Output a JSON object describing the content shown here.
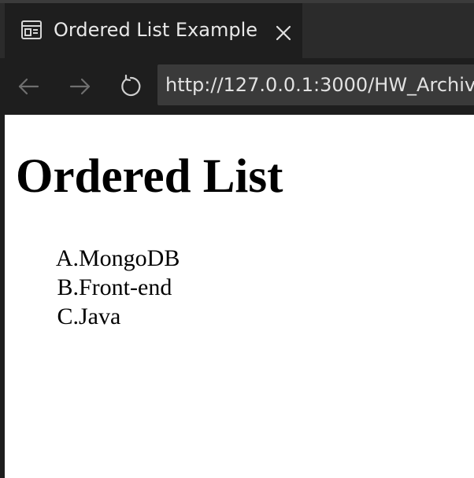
{
  "browser": {
    "tab": {
      "title": "Ordered List Example",
      "icon": "page-layout-icon",
      "close_icon": "close-icon"
    },
    "toolbar": {
      "back_icon": "arrow-left-icon",
      "forward_icon": "arrow-right-icon",
      "reload_icon": "reload-icon",
      "url": "http://127.0.0.1:3000/HW_Archiv"
    },
    "colors": {
      "chrome_background": "#1e1e1e",
      "tab_strip": "#2b2b2b",
      "url_bar": "#3a3a3a",
      "chrome_text": "#e8e8e8"
    }
  },
  "page": {
    "heading": "Ordered List",
    "list": [
      {
        "marker": "A.",
        "text": "MongoDB"
      },
      {
        "marker": "B.",
        "text": "Front-end"
      },
      {
        "marker": "C.",
        "text": "Java"
      }
    ]
  }
}
